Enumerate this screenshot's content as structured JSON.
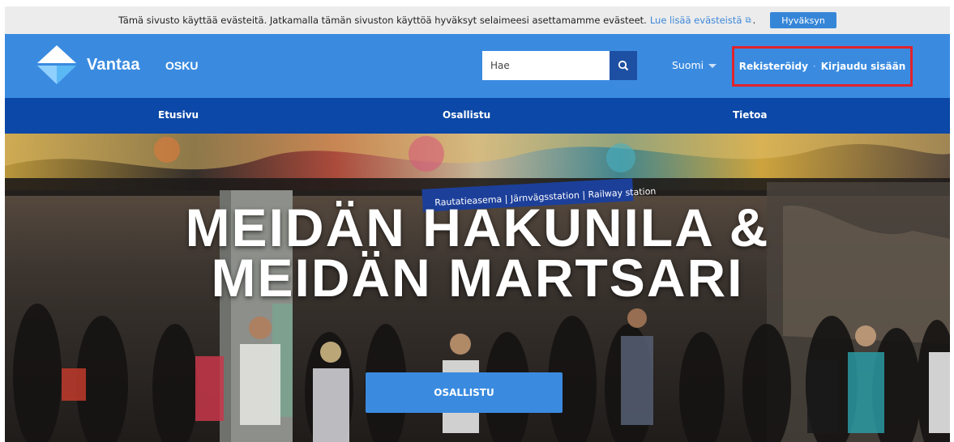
{
  "cookie_bar": {
    "message": "Tämä sivusto käyttää evästeitä. Jatkamalla tämän sivuston käyttöä hyväksyt selaimeesi asettamamme evästeet.",
    "link_text": "Lue lisää evästeistä",
    "link_icon": "external-link-icon",
    "trailing": ".",
    "accept_label": "Hyväksyn"
  },
  "header": {
    "brand": "Vantaa",
    "app_name": "OSKU",
    "search": {
      "placeholder": "Hae",
      "icon": "search-icon"
    },
    "language": {
      "label": "Suomi",
      "icon": "chevron-down-icon"
    },
    "auth": {
      "register_label": "Rekisteröidy",
      "separator": "·",
      "login_label": "Kirjaudu sisään"
    }
  },
  "nav": {
    "items": [
      {
        "label": "Etusivu"
      },
      {
        "label": "Osallistu"
      },
      {
        "label": "Tietoa"
      }
    ]
  },
  "hero": {
    "title_line1": "MEIDÄN HAKUNILA &",
    "title_line2": "MEIDÄN MARTSARI",
    "cta_label": "OSALLISTU",
    "sign_text": "Rautatieasema | Järnvägsstation | Railway station"
  },
  "colors": {
    "header_bg": "#3a8be0",
    "nav_bg": "#0b48a7",
    "accent": "#3686d8",
    "highlight_border": "#e2232b"
  }
}
